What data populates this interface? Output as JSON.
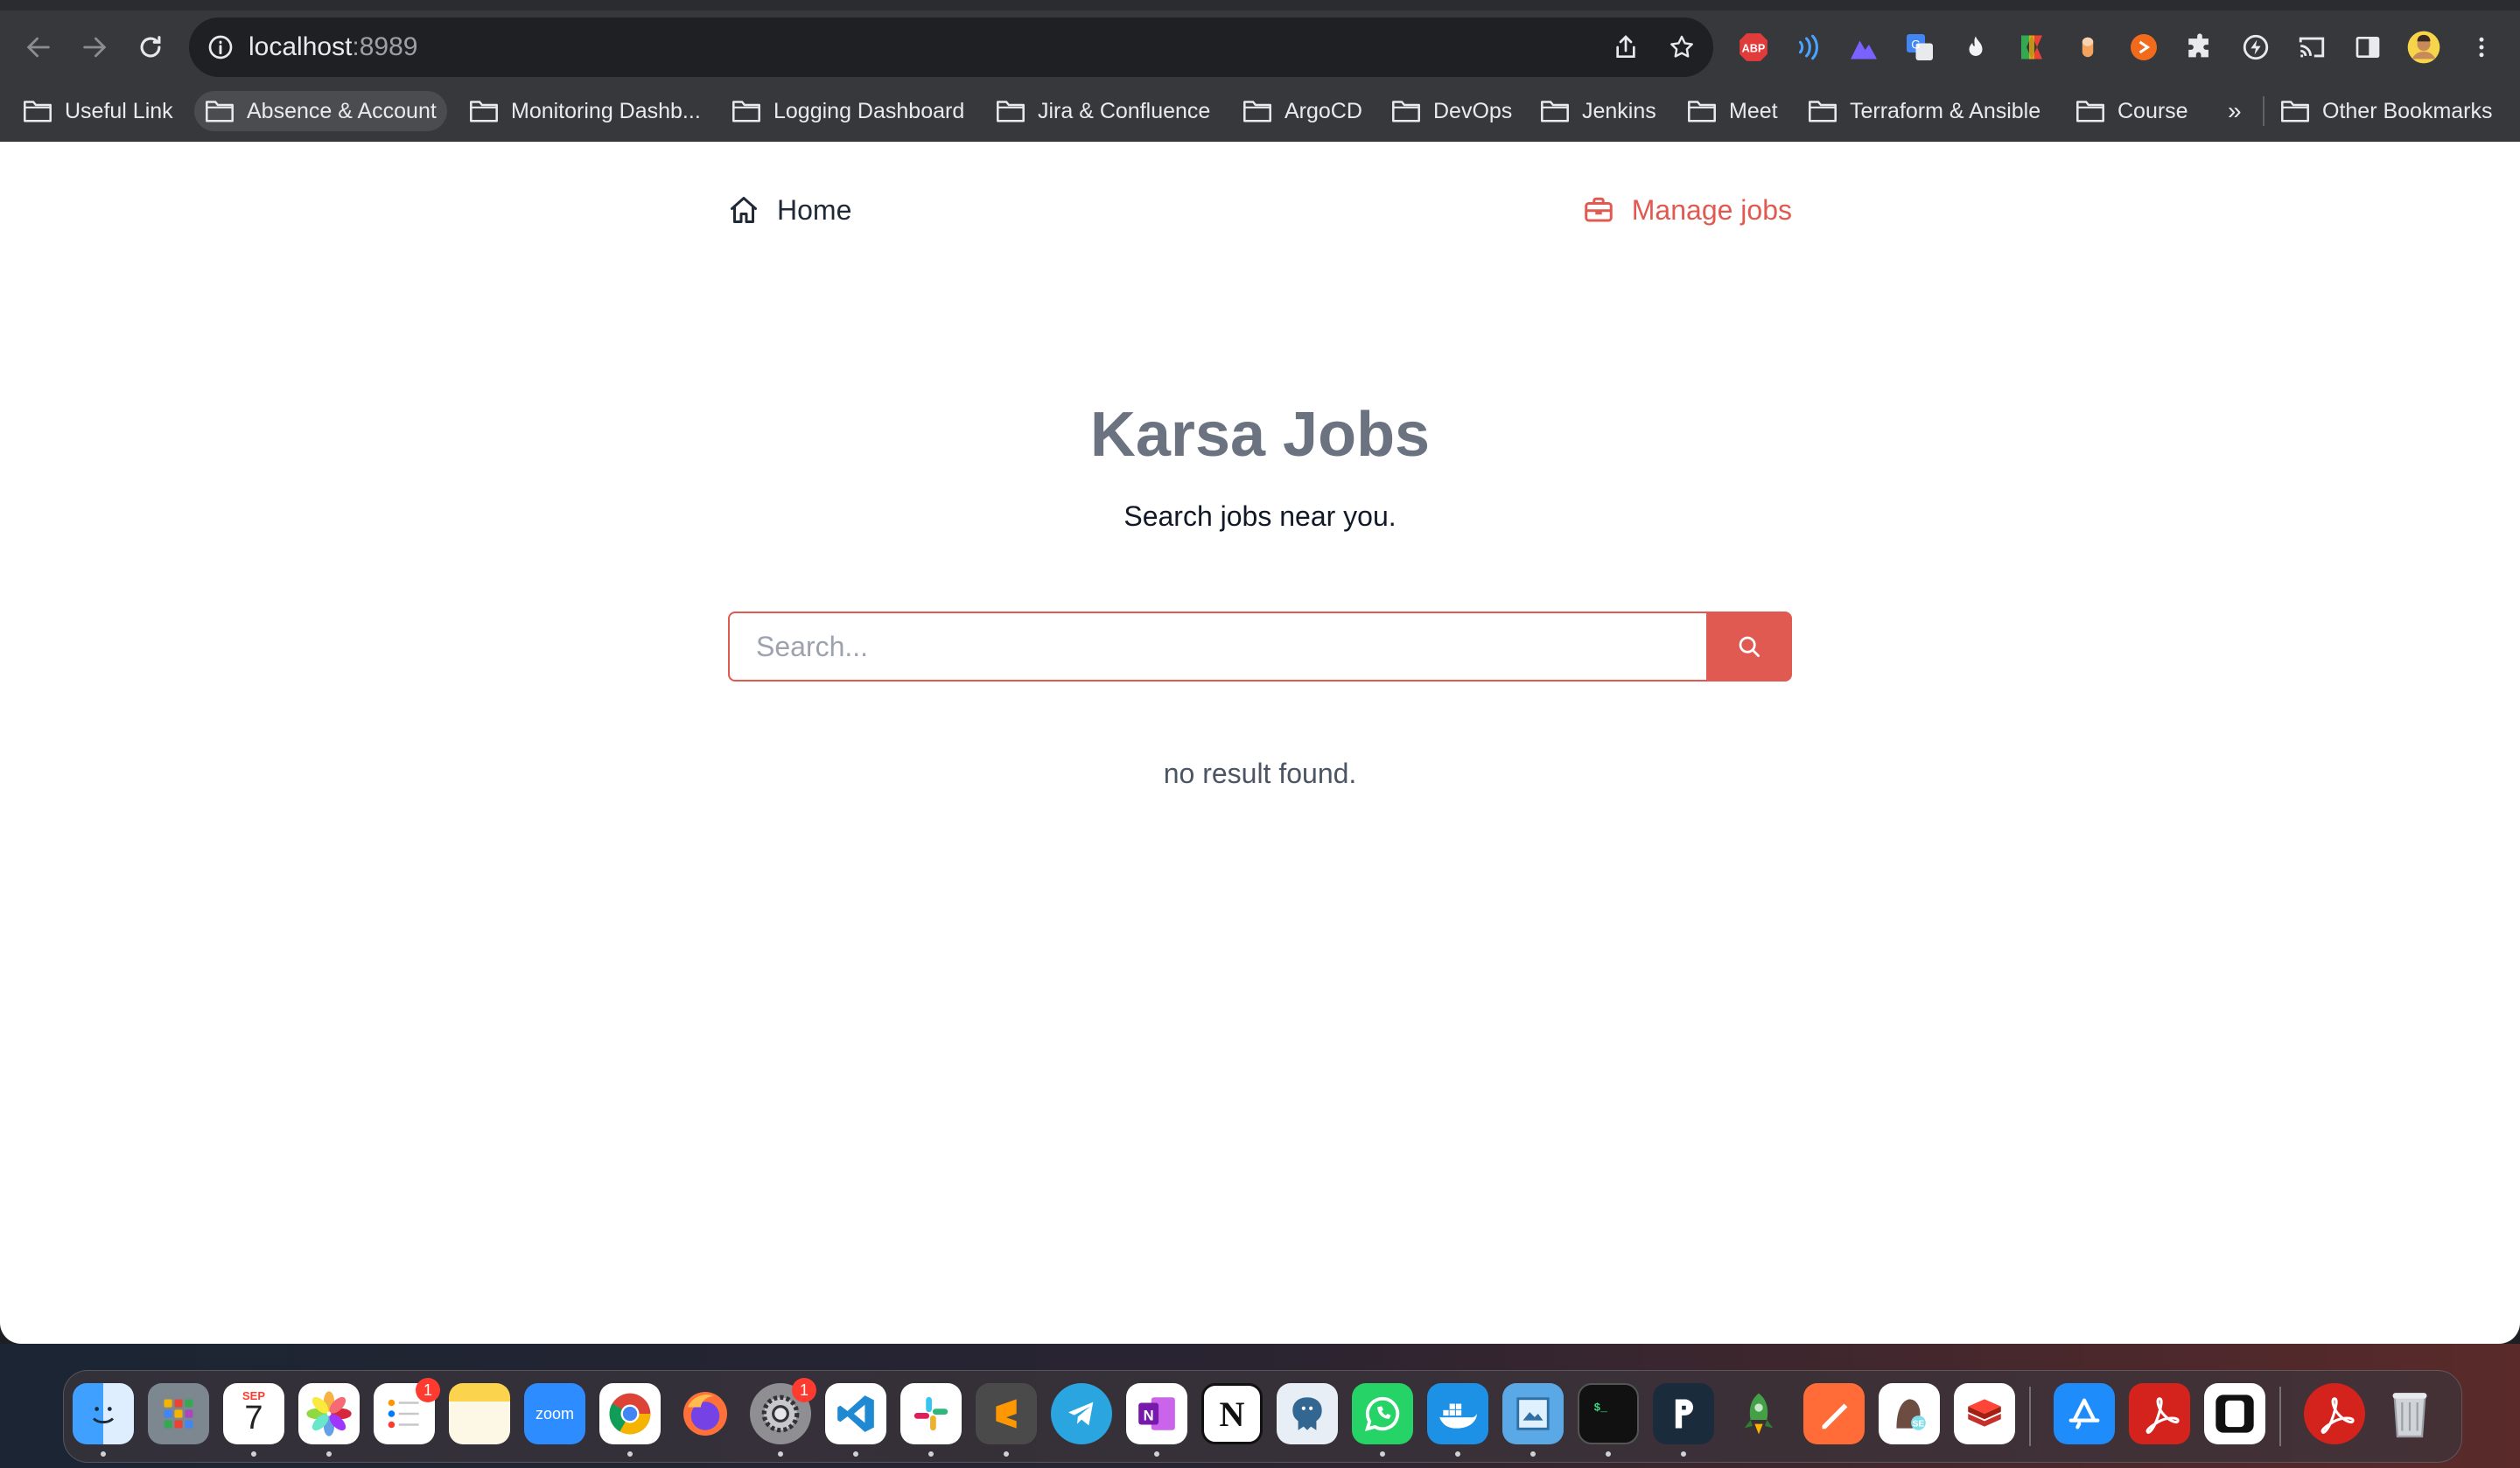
{
  "browser": {
    "url_host": "localhost",
    "url_port": ":8989",
    "bookmarks": [
      {
        "label": "Useful Link"
      },
      {
        "label": "Absence & Account"
      },
      {
        "label": "Monitoring Dashb..."
      },
      {
        "label": "Logging Dashboard"
      },
      {
        "label": "Jira & Confluence"
      },
      {
        "label": "ArgoCD"
      },
      {
        "label": "DevOps"
      },
      {
        "label": "Jenkins"
      },
      {
        "label": "Meet"
      },
      {
        "label": "Terraform & Ansible"
      },
      {
        "label": "Course"
      }
    ],
    "more_bookmarks": "»",
    "other_bookmarks": "Other Bookmarks",
    "extensions": [
      "adblock-icon",
      "wave-icon",
      "mountain-icon",
      "translate-icon",
      "flame-icon",
      "flag-icon",
      "capsule-icon",
      "orange-circle-icon",
      "puzzle-icon",
      "bolt-icon",
      "cast-icon",
      "sidepanel-icon",
      "profile-avatar",
      "more-vert-icon"
    ],
    "extension_labels": {
      "adblock": "ABP"
    }
  },
  "page": {
    "nav": {
      "home": "Home",
      "manage_jobs": "Manage jobs"
    },
    "title": "Karsa Jobs",
    "subtitle": "Search jobs near you.",
    "search": {
      "placeholder": "Search...",
      "value": ""
    },
    "empty_message": "no result found.",
    "colors": {
      "accent": "#e05a52",
      "title": "#6b7280"
    }
  },
  "dock": {
    "calendar": {
      "month": "SEP",
      "day": "7"
    },
    "badges": {
      "reminders": "1",
      "system_settings": "1"
    },
    "zoom_label": "zoom",
    "apps": [
      "finder",
      "launchpad",
      "calendar",
      "photos",
      "reminders",
      "notes",
      "zoom",
      "chrome",
      "firefox",
      "system-settings",
      "vscode",
      "slack",
      "sublime-text",
      "telegram",
      "onenote",
      "notion",
      "pgadmin",
      "whatsapp",
      "docker",
      "preview",
      "terminal",
      "postman-p",
      "rocket",
      "postman",
      "sequel-ace",
      "redis",
      "app-store",
      "acrobat",
      "iterm",
      "acrobat-2",
      "trash"
    ]
  }
}
